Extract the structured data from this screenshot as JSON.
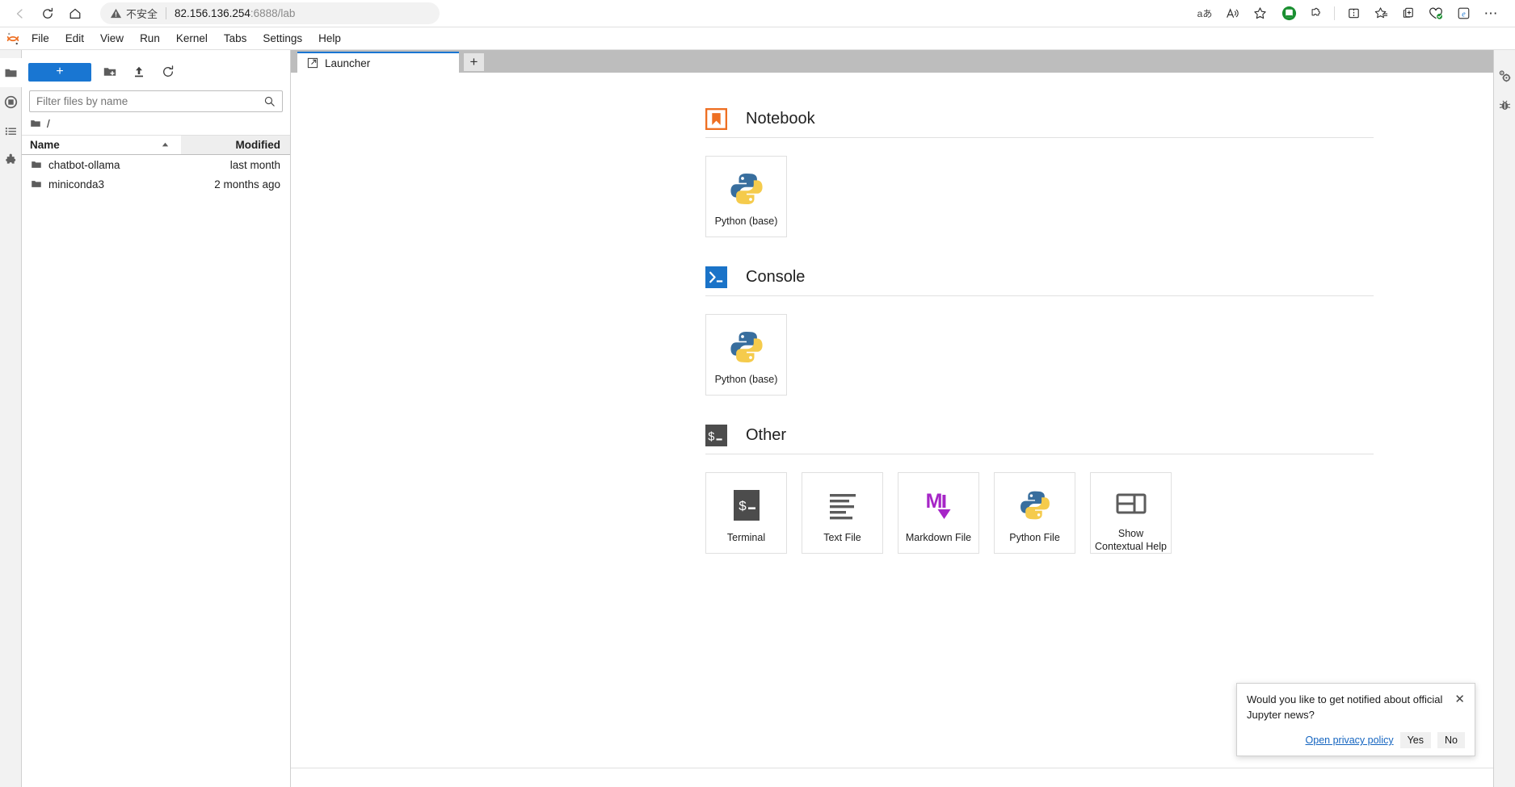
{
  "browser": {
    "nav": {
      "back_icon": "arrow-left-icon",
      "reload_icon": "reload-icon",
      "home_icon": "home-icon"
    },
    "omnibox": {
      "security_icon": "warning-triangle-icon",
      "security_label": "不安全",
      "url_host": "82.156.136.254",
      "url_rest": ":6888/lab"
    },
    "toolbar_icons": [
      {
        "name": "read-aloud-language-icon",
        "glyph": "aあ"
      },
      {
        "name": "read-aloud-icon",
        "glyph": "A"
      },
      {
        "name": "favorite-star-icon",
        "glyph": "☆"
      },
      {
        "name": "profile-icon",
        "glyph": ""
      },
      {
        "name": "extensions-puzzle-icon",
        "glyph": ""
      },
      {
        "name": "split-screen-icon",
        "glyph": ""
      },
      {
        "name": "collections-icon",
        "glyph": ""
      },
      {
        "name": "add-to-collections-icon",
        "glyph": ""
      },
      {
        "name": "browser-essentials-icon",
        "glyph": ""
      },
      {
        "name": "ie-mode-icon",
        "glyph": ""
      },
      {
        "name": "settings-and-more-icon",
        "glyph": "⋯"
      }
    ]
  },
  "jupyter": {
    "logo_name": "jupyter-logo",
    "menu": [
      {
        "label": "File"
      },
      {
        "label": "Edit"
      },
      {
        "label": "View"
      },
      {
        "label": "Run"
      },
      {
        "label": "Kernel"
      },
      {
        "label": "Tabs"
      },
      {
        "label": "Settings"
      },
      {
        "label": "Help"
      }
    ],
    "left_sidebar": [
      {
        "name": "file-browser-icon",
        "active": true
      },
      {
        "name": "running-terminals-icon",
        "active": false
      },
      {
        "name": "commands-list-icon",
        "active": false
      },
      {
        "name": "extension-manager-icon",
        "active": false
      }
    ],
    "right_sidebar": [
      {
        "name": "property-inspector-gear-icon"
      },
      {
        "name": "debugger-bug-icon"
      }
    ],
    "file_browser": {
      "new_launcher_label": "+",
      "new_folder_icon": "new-folder-icon",
      "upload_icon": "upload-icon",
      "refresh_icon": "refresh-icon",
      "filter_placeholder": "Filter files by name",
      "search_icon": "search-icon",
      "breadcrumb_root": "/",
      "columns": {
        "name": "Name",
        "modified": "Modified",
        "sort_direction": "ascending"
      },
      "items": [
        {
          "name": "chatbot-ollama",
          "modified": "last month",
          "icon": "folder-icon"
        },
        {
          "name": "miniconda3",
          "modified": "2 months ago",
          "icon": "folder-icon"
        }
      ]
    },
    "dock": {
      "tab": {
        "label": "Launcher",
        "icon": "launcher-icon"
      },
      "new_tab_label": "+"
    },
    "launcher": {
      "sections": [
        {
          "id": "notebook",
          "title": "Notebook",
          "icon": "notebook-bookmark-icon",
          "cards": [
            {
              "label": "Python (base)",
              "icon": "python-logo-icon"
            }
          ]
        },
        {
          "id": "console",
          "title": "Console",
          "icon": "console-prompt-icon",
          "cards": [
            {
              "label": "Python (base)",
              "icon": "python-logo-icon"
            }
          ]
        },
        {
          "id": "other",
          "title": "Other",
          "icon": "terminal-prompt-icon",
          "cards": [
            {
              "label": "Terminal",
              "icon": "terminal-icon"
            },
            {
              "label": "Text File",
              "icon": "text-file-icon"
            },
            {
              "label": "Markdown File",
              "icon": "markdown-file-icon"
            },
            {
              "label": "Python File",
              "icon": "python-file-icon"
            },
            {
              "label": "Show Contextual Help",
              "icon": "contextual-help-icon"
            }
          ]
        }
      ]
    },
    "notification": {
      "message": "Would you like to get notified about official Jupyter news?",
      "close_icon": "close-icon",
      "privacy_link": "Open privacy policy",
      "yes_label": "Yes",
      "no_label": "No"
    }
  },
  "colors": {
    "accent_blue": "#1976d2",
    "notebook_orange": "#ee6f22",
    "console_blue": "#1a73c8",
    "other_gray": "#4c4c4c",
    "markdown_purple": "#a626c7",
    "link_blue": "#1565c0"
  }
}
